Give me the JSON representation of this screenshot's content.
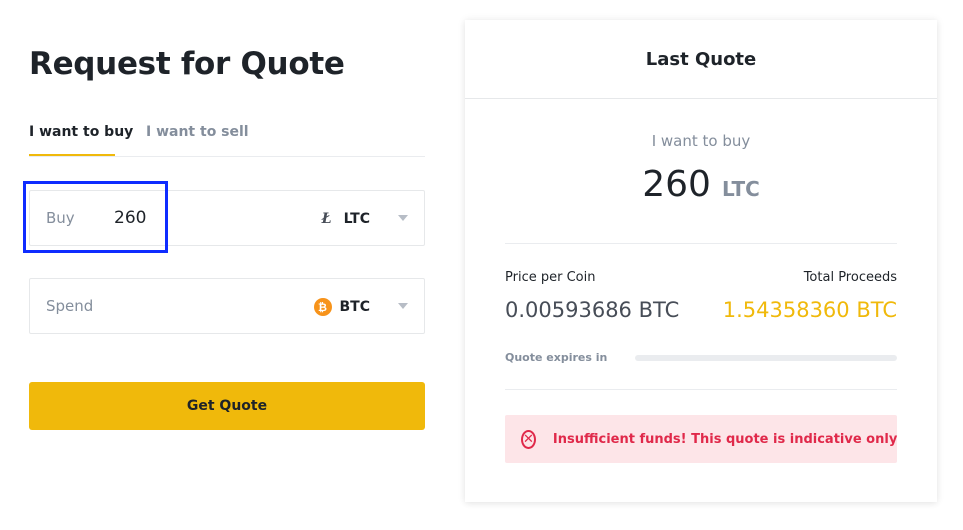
{
  "request": {
    "title": "Request for Quote",
    "tabs": [
      {
        "label": "I want to buy",
        "active": true
      },
      {
        "label": "I want to sell",
        "active": false
      }
    ],
    "buy_field": {
      "label": "Buy",
      "value": "260",
      "coin": "LTC",
      "coin_icon": "litecoin-icon"
    },
    "spend_field": {
      "label": "Spend",
      "value": "",
      "coin": "BTC",
      "coin_icon": "bitcoin-icon"
    },
    "get_quote_label": "Get Quote"
  },
  "last_quote": {
    "title": "Last Quote",
    "direction_label": "I want to buy",
    "amount": "260",
    "amount_unit": "LTC",
    "price_per_coin_label": "Price per Coin",
    "price_per_coin_value": "0.00593686 BTC",
    "total_proceeds_label": "Total Proceeds",
    "total_proceeds_value": "1.54358360 BTC",
    "expires_label": "Quote expires in",
    "expires_progress": 0,
    "alert_icon": "close-circle-icon",
    "alert_text": "Insufficient funds! This quote is indicative only"
  },
  "colors": {
    "accent": "#f0b90b",
    "error": "#e0294a",
    "error_bg": "#fde5e8",
    "highlight": "#0f2cff",
    "bitcoin": "#f7931a"
  }
}
